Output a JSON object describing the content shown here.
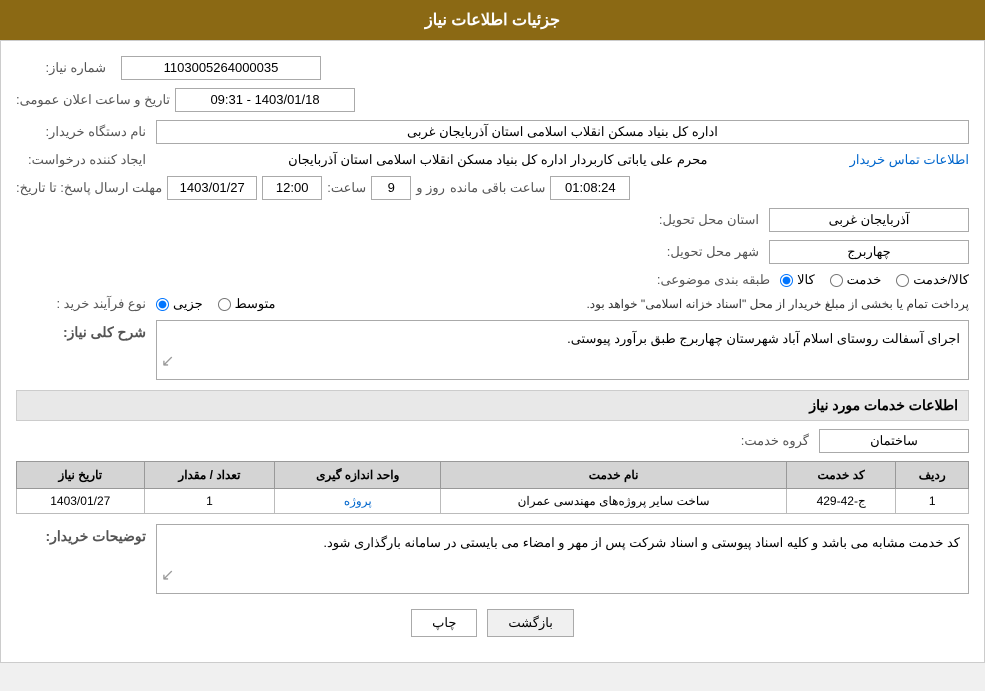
{
  "header": {
    "title": "جزئیات اطلاعات نیاز"
  },
  "fields": {
    "shomare_label": "شماره نیاز:",
    "shomare_value": "1103005264000035",
    "tarikh_label": "تاریخ و ساعت اعلان عمومی:",
    "tarikh_value": "1403/01/18 - 09:31",
    "nam_dastgah_label": "نام دستگاه خریدار:",
    "nam_dastgah_value": "اداره کل بنیاد مسکن انقلاب اسلامی استان آذربایجان غربی",
    "ijad_label": "ایجاد کننده درخواست:",
    "ijad_value": "محرم علی یاباتی کاربردار اداره کل بنیاد مسکن انقلاب اسلامی استان آذربایجان",
    "ijad_link": "اطلاعات تماس خریدار",
    "mohlat_label": "مهلت ارسال پاسخ: تا تاریخ:",
    "mohlat_date": "1403/01/27",
    "mohlat_saat_label": "ساعت:",
    "mohlat_saat": "12:00",
    "mohlat_rooz_label": "روز و",
    "mohlat_rooz": "9",
    "mohlat_baqi_label": "ساعت باقی مانده",
    "mohlat_baqi": "01:08:24",
    "ostan_label": "استان محل تحویل:",
    "ostan_value": "آذربایجان غربی",
    "shahr_label": "شهر محل تحویل:",
    "shahr_value": "چهاربرج",
    "tabagheh_label": "طبقه بندی موضوعی:",
    "tabagheh_kala": "کالا",
    "tabagheh_khedmat": "خدمت",
    "tabagheh_kala_khedmat": "کالا/خدمت",
    "nooe_label": "نوع فرآیند خرید :",
    "nooe_jozi": "جزیی",
    "nooe_motevaset": "متوسط",
    "nooe_description": "پرداخت تمام یا بخشی از مبلغ خریدار از محل \"اسناد خزانه اسلامی\" خواهد بود.",
    "sharh_label": "شرح کلی نیاز:",
    "sharh_value": "اجرای آسفالت روستای اسلام آباد شهرستان چهاربرج طبق برآورد پیوستی.",
    "khadamat_label": "اطلاعات خدمات مورد نیاز",
    "grohe_label": "گروه خدمت:",
    "grohe_value": "ساختمان",
    "table": {
      "headers": [
        "ردیف",
        "کد خدمت",
        "نام خدمت",
        "واحد اندازه گیری",
        "تعداد / مقدار",
        "تاریخ نیاز"
      ],
      "rows": [
        {
          "radif": "1",
          "kod": "ج-42-429",
          "nam": "ساخت سایر پروژه‌های مهندسی عمران",
          "vahed": "پروژه",
          "tedad": "1",
          "tarikh": "1403/01/27"
        }
      ]
    },
    "tozihat_label": "توضیحات خریدار:",
    "tozihat_value": "کد خدمت مشابه می باشد و کلیه اسناد پیوستی و اسناد شرکت پس از مهر و امضاء می بایستی در سامانه بارگذاری شود.",
    "btn_chap": "چاپ",
    "btn_bazgasht": "بازگشت"
  }
}
